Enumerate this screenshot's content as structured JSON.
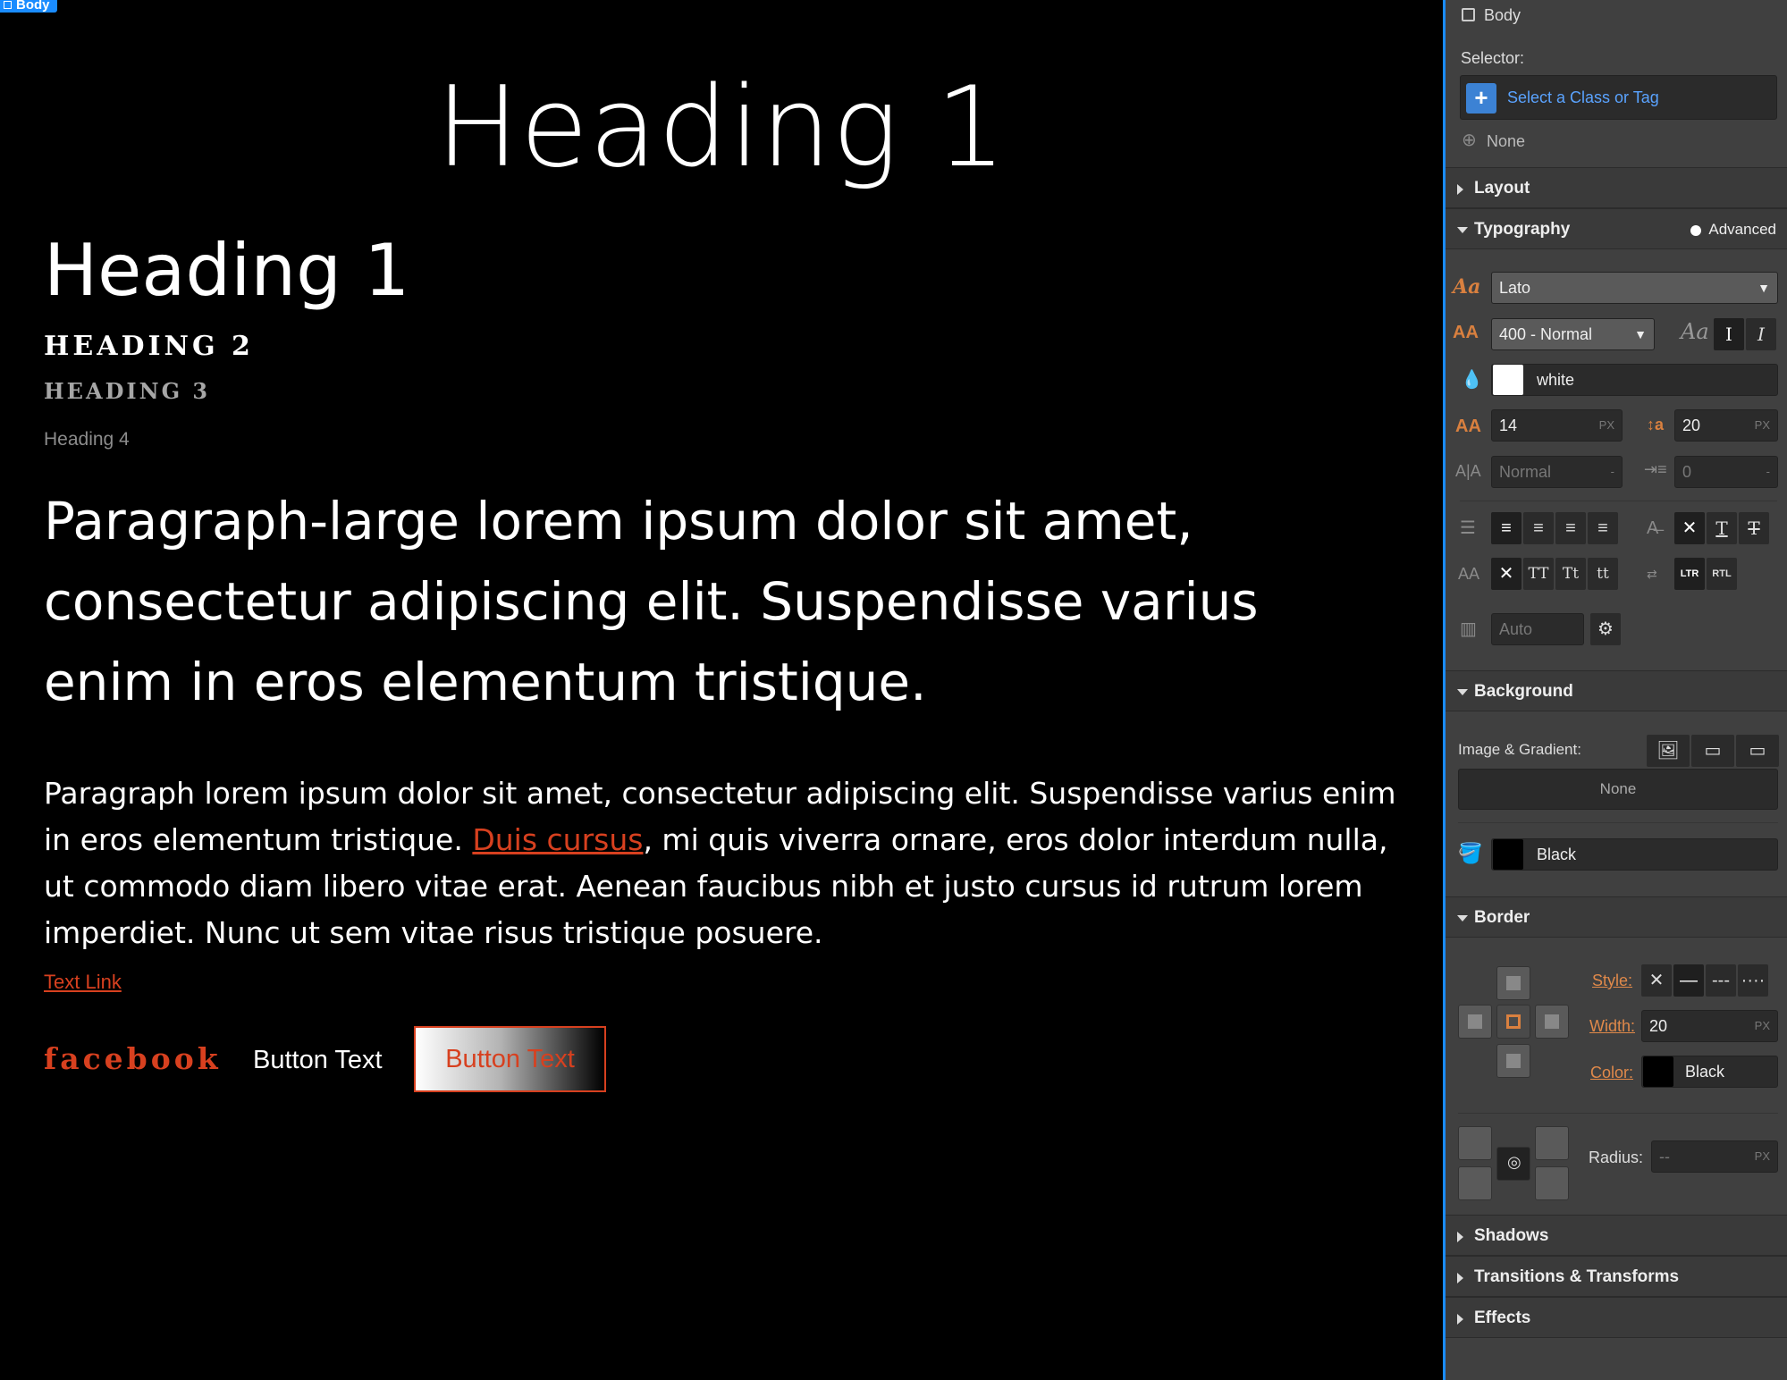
{
  "canvas": {
    "selection_tag": "Body",
    "heading_center": "Heading 1",
    "heading1": "Heading 1",
    "heading2": "HEADING 2",
    "heading3": "HEADING 3",
    "heading4": "Heading 4",
    "paragraph_large": "Paragraph-large lorem ipsum dolor sit amet, consectetur adipiscing elit. Suspendisse varius enim in eros elementum tristique.",
    "paragraph_before_link": "Paragraph lorem ipsum dolor sit amet, consectetur adipiscing elit. Suspendisse varius enim in eros elementum tristique. ",
    "paragraph_link": "Duis cursus",
    "paragraph_after_link": ", mi quis viverra ornare, eros dolor interdum nulla, ut commodo diam libero vitae erat. Aenean faucibus nibh et justo cursus id rutrum lorem imperdiet. Nunc ut sem vitae risus tristique posuere.",
    "text_link": "Text Link",
    "facebook_link": "facebook",
    "button_text_plain": "Button Text",
    "button_text_gradient": "Button Text",
    "accent_color": "#d7401f"
  },
  "panel": {
    "element_name": "Body",
    "selector_label": "Selector:",
    "selector_placeholder": "Select a Class or Tag",
    "selector_state": "None",
    "sections": {
      "layout": "Layout",
      "typography": "Typography",
      "background": "Background",
      "border": "Border",
      "shadows": "Shadows",
      "transitions": "Transitions & Transforms",
      "effects": "Effects"
    },
    "typography": {
      "advanced_label": "Advanced",
      "font_family": "Lato",
      "font_weight": "400 - Normal",
      "style_preview": "Aa",
      "color_name": "white",
      "font_size": "14",
      "font_size_unit": "PX",
      "line_height": "20",
      "line_height_unit": "PX",
      "letter_spacing": "Normal",
      "letter_spacing_unit": "-",
      "text_indent": "0",
      "text_indent_unit": "-",
      "columns": "Auto",
      "case_none": "✕",
      "case_upper": "TT",
      "case_title": "Tt",
      "case_lower": "tt",
      "dir_ltr": "LTR",
      "dir_rtl": "RTL"
    },
    "background": {
      "image_gradient_label": "Image & Gradient:",
      "image_gradient_value": "None",
      "color_name": "Black"
    },
    "border": {
      "style_label": "Style:",
      "width_label": "Width:",
      "width_value": "20",
      "width_unit": "PX",
      "color_label": "Color:",
      "color_name": "Black",
      "radius_label": "Radius:",
      "radius_value": "--",
      "radius_unit": "PX"
    },
    "colors": {
      "panel_bg": "#404040",
      "accent_orange": "#d9803f",
      "selection_blue": "#1a8cff"
    }
  }
}
